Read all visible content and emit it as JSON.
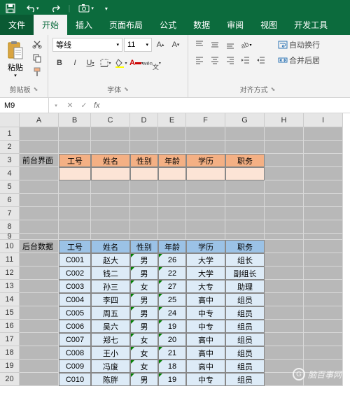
{
  "titlebar": {
    "save_icon": "save-icon",
    "undo_icon": "undo-icon",
    "redo_icon": "redo-icon"
  },
  "tabs": {
    "file": "文件",
    "home": "开始",
    "insert": "插入",
    "layout": "页面布局",
    "formula": "公式",
    "data": "数据",
    "review": "审阅",
    "view": "视图",
    "dev": "开发工具"
  },
  "ribbon": {
    "clipboard": {
      "label": "剪贴板",
      "paste": "粘贴"
    },
    "font": {
      "label": "字体",
      "name": "等线",
      "size": "11",
      "bold": "B",
      "italic": "I",
      "underline": "U"
    },
    "align": {
      "label": "对齐方式",
      "wrap": "自动换行",
      "merge": "合并后居"
    }
  },
  "formula_bar": {
    "name_box": "M9",
    "fx": "fx",
    "value": ""
  },
  "columns": [
    "A",
    "B",
    "C",
    "D",
    "E",
    "F",
    "G",
    "H",
    "I"
  ],
  "rows": [
    "1",
    "2",
    "3",
    "4",
    "5",
    "6",
    "7",
    "8",
    "9",
    "10",
    "11",
    "12",
    "13",
    "14",
    "15",
    "16",
    "17",
    "18",
    "19",
    "20"
  ],
  "section_labels": {
    "front": "前台界面",
    "back": "后台数据"
  },
  "headers": [
    "工号",
    "姓名",
    "性别",
    "年龄",
    "学历",
    "职务"
  ],
  "back_data": [
    [
      "C001",
      "赵大",
      "男",
      "26",
      "大学",
      "组长"
    ],
    [
      "C002",
      "钱二",
      "男",
      "22",
      "大学",
      "副组长"
    ],
    [
      "C003",
      "孙三",
      "女",
      "27",
      "大专",
      "助理"
    ],
    [
      "C004",
      "李四",
      "男",
      "25",
      "高中",
      "组员"
    ],
    [
      "C005",
      "周五",
      "男",
      "24",
      "中专",
      "组员"
    ],
    [
      "C006",
      "吴六",
      "男",
      "19",
      "中专",
      "组员"
    ],
    [
      "C007",
      "郑七",
      "女",
      "20",
      "高中",
      "组员"
    ],
    [
      "C008",
      "王小",
      "女",
      "21",
      "高中",
      "组员"
    ],
    [
      "C009",
      "冯废",
      "女",
      "18",
      "高中",
      "组员"
    ],
    [
      "C010",
      "陈胖",
      "男",
      "19",
      "中专",
      "组员"
    ]
  ],
  "watermark": "脑百事网"
}
